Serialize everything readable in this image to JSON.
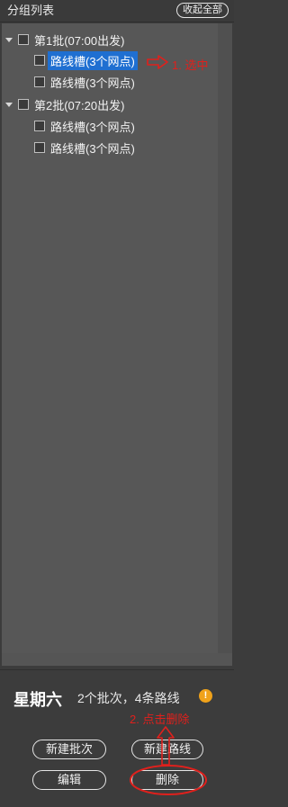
{
  "header": {
    "title": "分组列表",
    "collapse_label": "收起全部"
  },
  "tree": {
    "batches": [
      {
        "label": "第1批(07:00出发)",
        "routes": [
          {
            "label": "路线槽(3个网点)",
            "selected": true
          },
          {
            "label": "路线槽(3个网点)",
            "selected": false
          }
        ]
      },
      {
        "label": "第2批(07:20出发)",
        "routes": [
          {
            "label": "路线槽(3个网点)",
            "selected": false
          },
          {
            "label": "路线槽(3个网点)",
            "selected": false
          }
        ]
      }
    ]
  },
  "annotations": {
    "step1": "1. 选中",
    "step2": "2. 点击删除",
    "color": "#e0201c"
  },
  "footer": {
    "weekday": "星期六",
    "summary": "2个批次，4条路线",
    "info_icon": "!",
    "buttons": {
      "new_batch": "新建批次",
      "new_route": "新建路线",
      "edit": "编辑",
      "delete": "删除"
    }
  },
  "colors": {
    "selection": "#1f6fd1",
    "info": "#f0a21a"
  }
}
